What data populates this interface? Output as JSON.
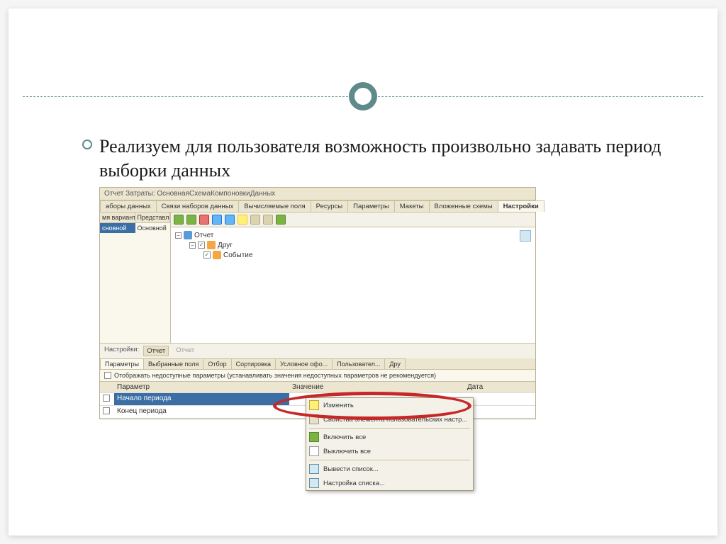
{
  "headline": "Реализуем  для пользователя возможность произвольно задавать период выборки данных",
  "app": {
    "title": "Отчет Затраты: ОсновнаяСхемаКомпоновкиДанных",
    "tabs": [
      {
        "label": "аборы данных"
      },
      {
        "label": "Связи наборов данных"
      },
      {
        "label": "Вычисляемые поля"
      },
      {
        "label": "Ресурсы"
      },
      {
        "label": "Параметры"
      },
      {
        "label": "Макеты"
      },
      {
        "label": "Вложенные схемы"
      },
      {
        "label": "Настройки"
      }
    ],
    "variants": {
      "columns": [
        "мя варианта",
        "Представление"
      ],
      "rows": [
        {
          "name": "сновной",
          "repr": "Основной"
        }
      ]
    },
    "tree": {
      "root": "Отчет",
      "children": [
        {
          "label": "Друг",
          "checked": true
        },
        {
          "label": "Событие",
          "checked": true
        }
      ]
    },
    "settings": {
      "label": "Настройки:",
      "activeLink": "Отчет",
      "inactiveLink": "Отчет",
      "subTabs": [
        {
          "label": "Параметры"
        },
        {
          "label": "Выбранные поля"
        },
        {
          "label": "Отбор"
        },
        {
          "label": "Сортировка"
        },
        {
          "label": "Условное офо..."
        },
        {
          "label": "Пользовател..."
        },
        {
          "label": "Дру"
        }
      ],
      "hint": "Отображать недоступные параметры (устанавливать значения недоступных параметров не рекомендуется)",
      "paramTable": {
        "headers": {
          "param": "Параметр",
          "value": "Значение",
          "date": "Дата"
        },
        "rows": [
          {
            "param": "Начало периода"
          },
          {
            "param": "Конец периода"
          }
        ]
      }
    },
    "contextMenu": {
      "items": [
        {
          "key": "edit",
          "label": "Изменить"
        },
        {
          "key": "props",
          "label": "Свойства элемента пользовательских настр..."
        },
        {
          "key": "divider"
        },
        {
          "key": "checkAll",
          "label": "Включить все"
        },
        {
          "key": "uncheckAll",
          "label": "Выключить все"
        },
        {
          "key": "divider"
        },
        {
          "key": "outputList",
          "label": "Вывести список..."
        },
        {
          "key": "listSettings",
          "label": "Настройка списка..."
        }
      ]
    }
  }
}
